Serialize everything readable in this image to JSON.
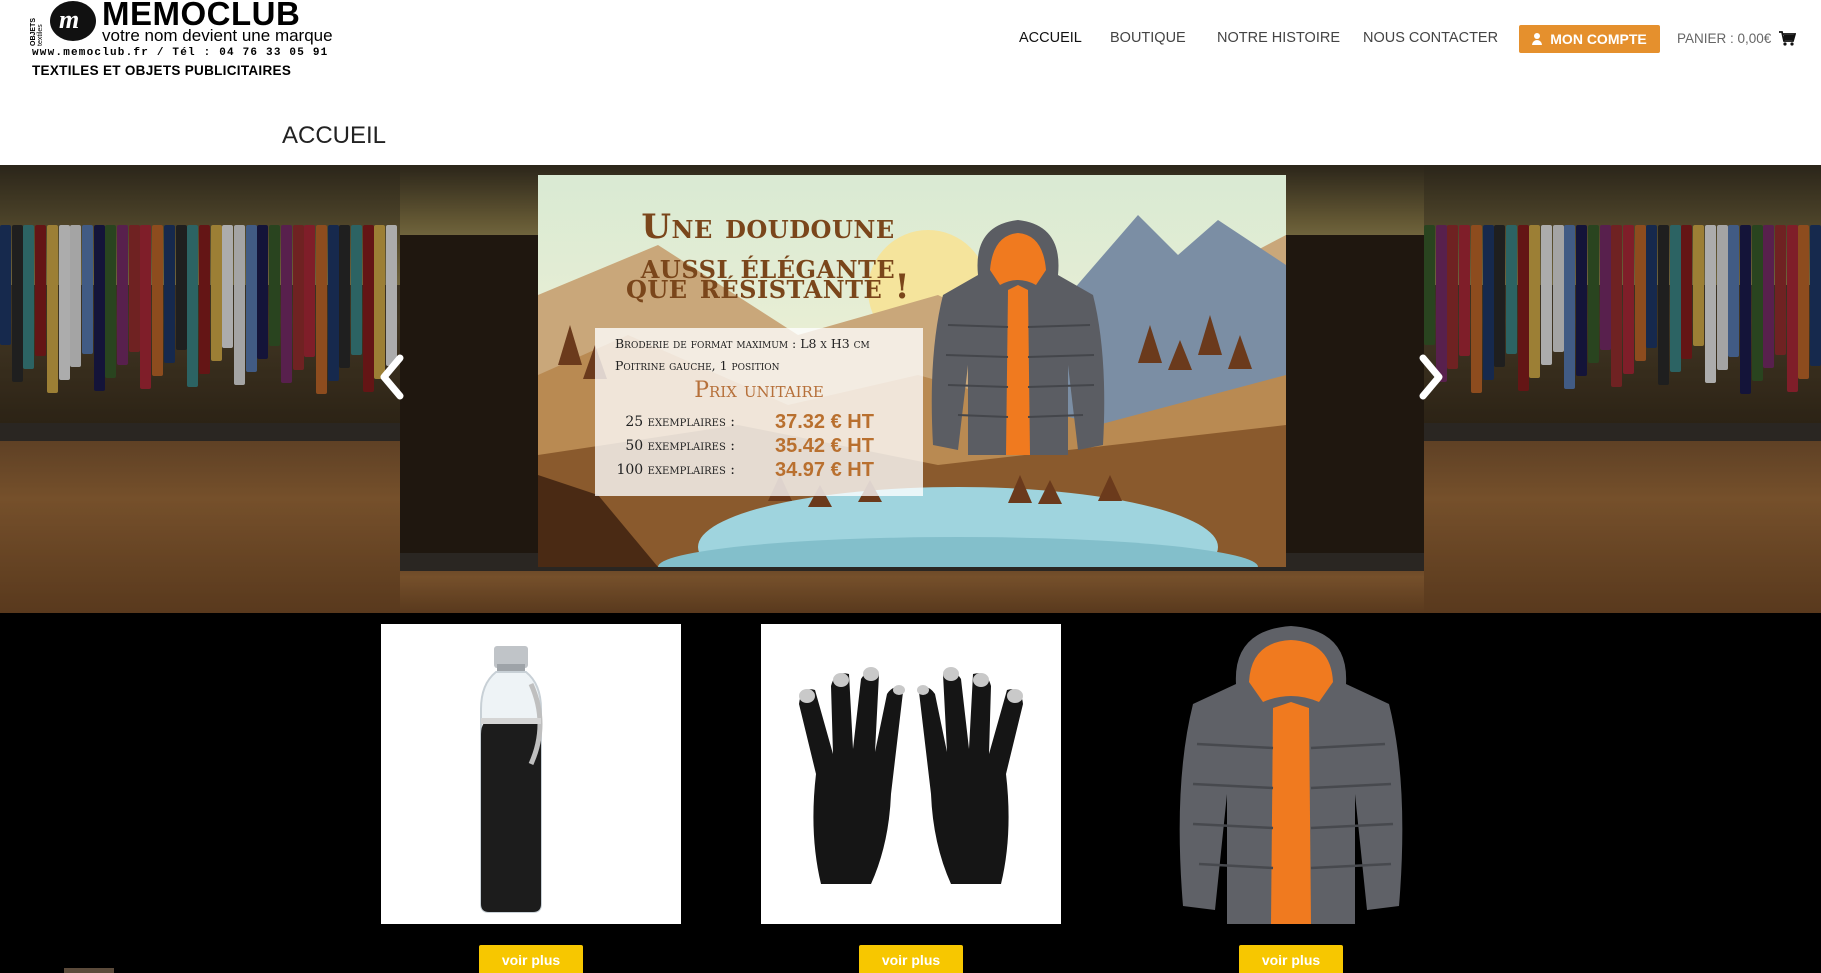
{
  "brand": {
    "name": "MEMOCLUB",
    "tagline": "votre nom devient une marque",
    "contact": "www.memoclub.fr / Tél : 04 76 33 05 91",
    "subtitle": "TEXTILES ET OBJETS PUBLICITAIRES",
    "side_top": "OBJETS",
    "side_bottom": "textiles"
  },
  "nav": {
    "items": [
      {
        "label": "ACCUEIL",
        "active": true
      },
      {
        "label": "BOUTIQUE"
      },
      {
        "label": "NOTRE HISTOIRE"
      },
      {
        "label": "NOUS CONTACTER"
      }
    ],
    "account_label": "MON COMPTE",
    "account_icon": "user-icon",
    "cart_label": "PANIER : 0,00€",
    "cart_icon": "cart-icon"
  },
  "page_title": "ACCUEIL",
  "slider": {
    "banner": {
      "title_line1": "Une doudoune aussi élégante",
      "title_line2": "que résistante !",
      "detail_line1": "Broderie de format maximum :   L8 x H3 cm",
      "detail_line2": "Poitrine gauche, 1 position",
      "price_heading": "Prix unitaire",
      "prices": [
        {
          "qty": "25 exemplaires :",
          "price": "37.32 € HT"
        },
        {
          "qty": "50 exemplaires :",
          "price": "35.42 € HT"
        },
        {
          "qty": "100 exemplaires :",
          "price": "34.97 € HT"
        }
      ]
    },
    "prev_icon": "chevron-left-icon",
    "next_icon": "chevron-right-icon"
  },
  "products": [
    {
      "image": "water-bottle",
      "button": "voir plus"
    },
    {
      "image": "touch-gloves",
      "button": "voir plus"
    },
    {
      "image": "puffer-jacket",
      "button": "voir plus"
    }
  ],
  "colors": {
    "accent_orange": "#e5902d",
    "button_yellow": "#f7c700",
    "banner_brown": "#7a461b",
    "price_orange": "#b9702f"
  }
}
